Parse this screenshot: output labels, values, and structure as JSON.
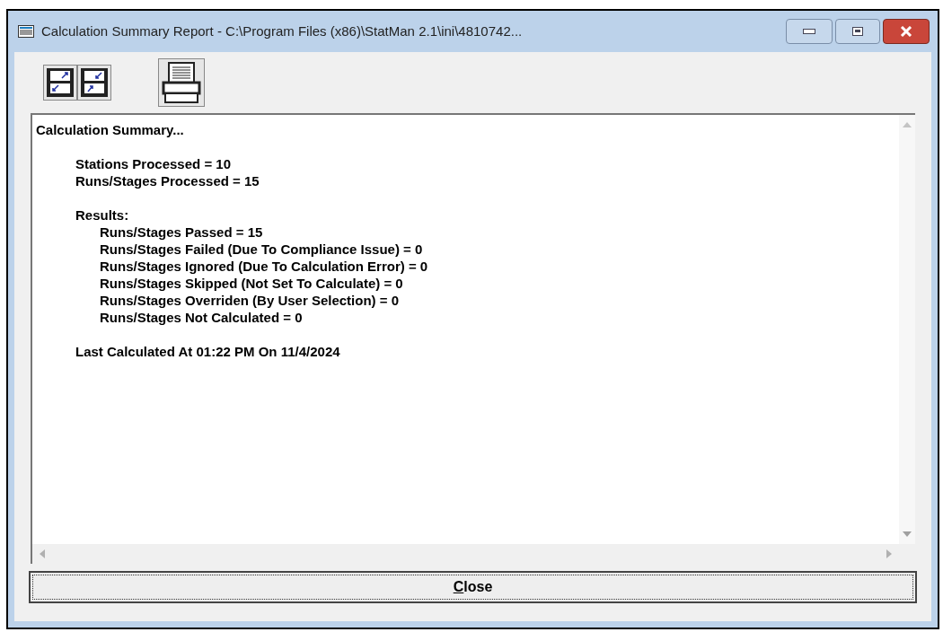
{
  "window": {
    "title": "Calculation Summary Report - C:\\Program Files (x86)\\StatMan 2.1\\ini\\4810742..."
  },
  "report": {
    "heading": "Calculation Summary...",
    "stats": [
      "Stations Processed = 10",
      "Runs/Stages Processed = 15"
    ],
    "results": {
      "label": "Results:",
      "items": [
        "Runs/Stages Passed = 15",
        "Runs/Stages Failed (Due To Compliance Issue) = 0",
        "Runs/Stages Ignored (Due To Calculation Error) = 0",
        "Runs/Stages Skipped (Not Set To Calculate) = 0",
        "Runs/Stages Overriden (By User Selection) = 0",
        "Runs/Stages Not Calculated = 0"
      ]
    },
    "last_calculated": "Last Calculated At 01:22 PM On 11/4/2024"
  },
  "close_button": {
    "label_parts": [
      {
        "text": "C",
        "underlined": true
      },
      {
        "text": "lose",
        "underlined": false
      }
    ]
  }
}
